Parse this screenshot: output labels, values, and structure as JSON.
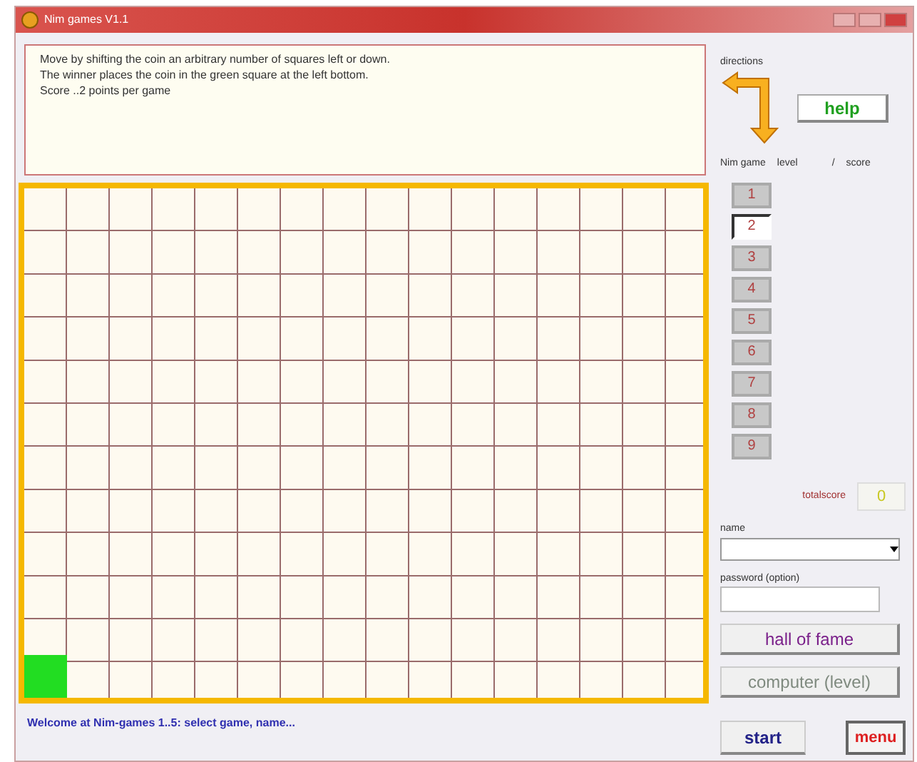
{
  "window": {
    "title": "Nim games V1.1"
  },
  "instructions": [
    "Move by shifting the coin an arbitrary number of squares left or down.",
    "The winner places the coin in the green square at the left bottom.",
    "Score ..2 points per game"
  ],
  "directions_label": "directions",
  "help_button": "help",
  "level_header": {
    "game": "Nim game",
    "level": "level",
    "slash": "/",
    "score": "score"
  },
  "levels": [
    {
      "label": "1",
      "selected": false
    },
    {
      "label": "2",
      "selected": true
    },
    {
      "label": "3",
      "selected": false
    },
    {
      "label": "4",
      "selected": false
    },
    {
      "label": "5",
      "selected": false
    },
    {
      "label": "6",
      "selected": false
    },
    {
      "label": "7",
      "selected": false
    },
    {
      "label": "8",
      "selected": false
    },
    {
      "label": "9",
      "selected": false
    }
  ],
  "totalscore": {
    "label": "totalscore",
    "value": "0"
  },
  "name_label": "name",
  "password_label": "password (option)",
  "buttons": [
    {
      "label": "hall of fame",
      "disabled": false
    },
    {
      "label": "computer (level)",
      "disabled": true
    }
  ],
  "start_button": "start",
  "menu_button": "menu",
  "status": "Welcome at Nim-games 1..5: select game, name..."
}
